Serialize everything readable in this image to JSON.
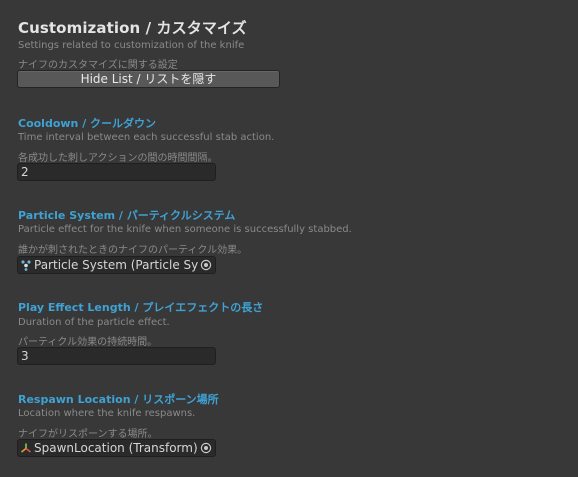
{
  "header": {
    "title": "Customization / カスタマイズ",
    "desc_en": "Settings related to customization of the knife",
    "desc_ja": "ナイフのカスタマイズに関する設定",
    "hide_button": "Hide List / リストを隠す"
  },
  "cooldown": {
    "label": "Cooldown / クールダウン",
    "desc_en": "Time interval between each successful stab action.",
    "desc_ja": "各成功した刺しアクションの間の時間間隔。",
    "value": "2"
  },
  "particle": {
    "label": "Particle System / パーティクルシステム",
    "desc_en": "Particle effect for the knife when someone is successfully stabbed.",
    "desc_ja": "誰かが刺されたときのナイフのパーティクル効果。",
    "value": "Particle System (Particle System)",
    "icon": "particle-system-icon"
  },
  "effect_length": {
    "label": "Play Effect Length / プレイエフェクトの長さ",
    "desc_en": "Duration of the particle effect.",
    "desc_ja": "パーティクル効果の持続時間。",
    "value": "3"
  },
  "respawn": {
    "label": "Respawn Location / リスポーン場所",
    "desc_en": "Location where the knife respawns.",
    "desc_ja": "ナイフがリスポーンする場所。",
    "value": "SpawnLocation (Transform)",
    "icon": "transform-icon"
  },
  "colors": {
    "background": "#383838",
    "label_accent": "#3fa2d4",
    "field_bg": "#2a2a2a"
  }
}
